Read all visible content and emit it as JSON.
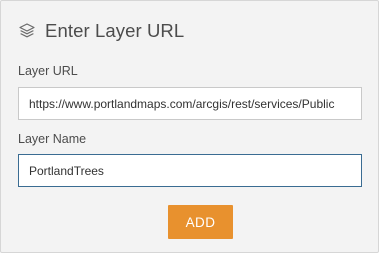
{
  "dialog": {
    "title": "Enter Layer URL",
    "title_icon": "layers-icon"
  },
  "layer_url": {
    "label": "Layer URL",
    "value": "https://www.portlandmaps.com/arcgis/rest/services/Public"
  },
  "layer_name": {
    "label": "Layer Name",
    "value": "PortlandTrees"
  },
  "actions": {
    "add_label": "ADD"
  },
  "colors": {
    "panel_background": "#f3f3f3",
    "accent": "#e8912e",
    "focus_border": "#3a6c92",
    "text": "#4c4c4c"
  }
}
